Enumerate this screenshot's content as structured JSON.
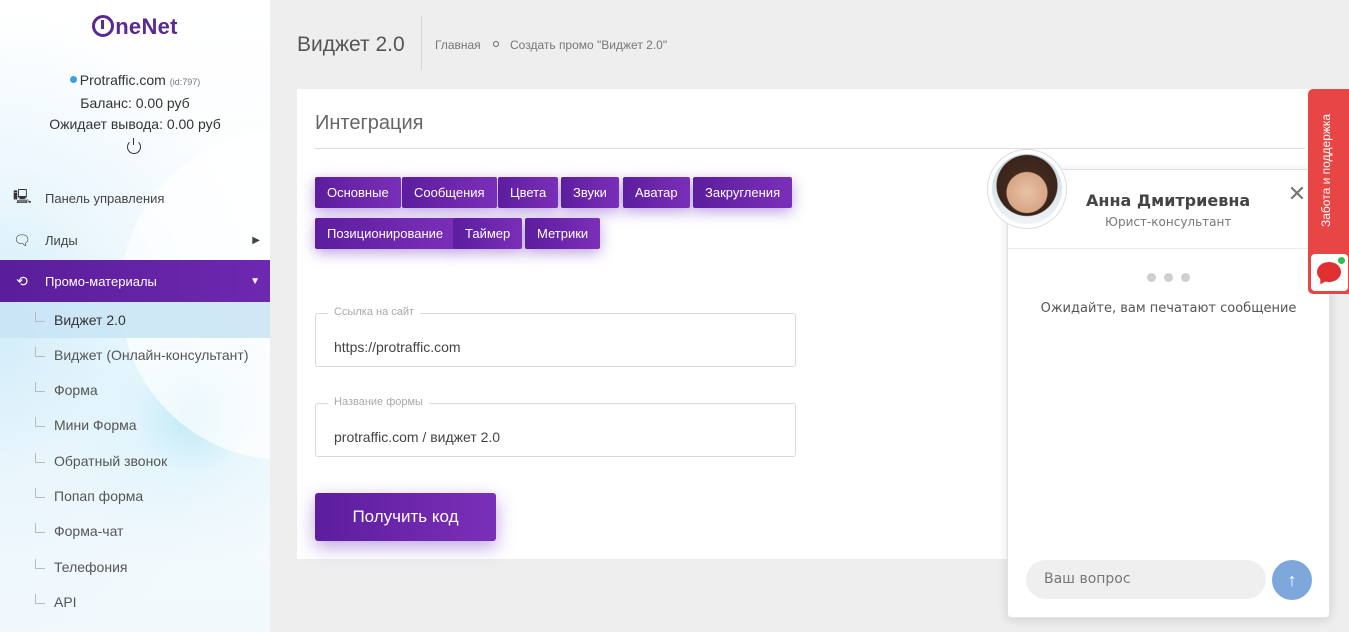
{
  "brand": {
    "logo_o": "O",
    "logo_rest": "neNet"
  },
  "account": {
    "site": "Protraffic.com",
    "id": "(id:797)",
    "balance": "Баланс: 0.00 руб",
    "pending": "Ожидает вывода: 0.00 руб"
  },
  "sidebar": {
    "menu": [
      {
        "label": "Панель управления",
        "icon": "monitor-icon"
      },
      {
        "label": "Лиды",
        "icon": "chat-icon"
      },
      {
        "label": "Промо-материалы",
        "icon": "promo-icon"
      }
    ],
    "submenu": [
      {
        "label": "Виджет 2.0"
      },
      {
        "label": "Виджет (Онлайн-консультант)"
      },
      {
        "label": "Форма"
      },
      {
        "label": "Мини Форма"
      },
      {
        "label": "Обратный звонок"
      },
      {
        "label": "Попап форма"
      },
      {
        "label": "Форма-чат"
      },
      {
        "label": "Телефония"
      },
      {
        "label": "API"
      }
    ]
  },
  "header": {
    "title": "Виджет 2.0",
    "breadcrumbs": [
      "Главная",
      "Создать промо \"Виджет 2.0\""
    ]
  },
  "card": {
    "title": "Интеграция",
    "tabs": [
      "Основные",
      "Сообщения",
      "Цвета",
      "Звуки",
      "Аватар",
      "Закругления",
      "Позиционирование",
      "Таймер",
      "Метрики"
    ],
    "fields": [
      {
        "label": "Ссылка на сайт",
        "value": "https://protraffic.com"
      },
      {
        "label": "Название формы",
        "value": "protraffic.com / виджет 2.0"
      }
    ],
    "submit_label": "Получить код"
  },
  "chat": {
    "agent_name": "Анна Дмитриевна",
    "agent_role": "Юрист-консультант",
    "close_glyph": "✕",
    "typing_text": "Ожидайте, вам печатают сообщение",
    "input_placeholder": "Ваш вопрос",
    "send_glyph": "↑"
  },
  "support_tab": {
    "label": "Забота и поддержка"
  },
  "colors": {
    "accent": "#6a24a8",
    "support": "#e84545",
    "send": "#7ea8dc"
  }
}
